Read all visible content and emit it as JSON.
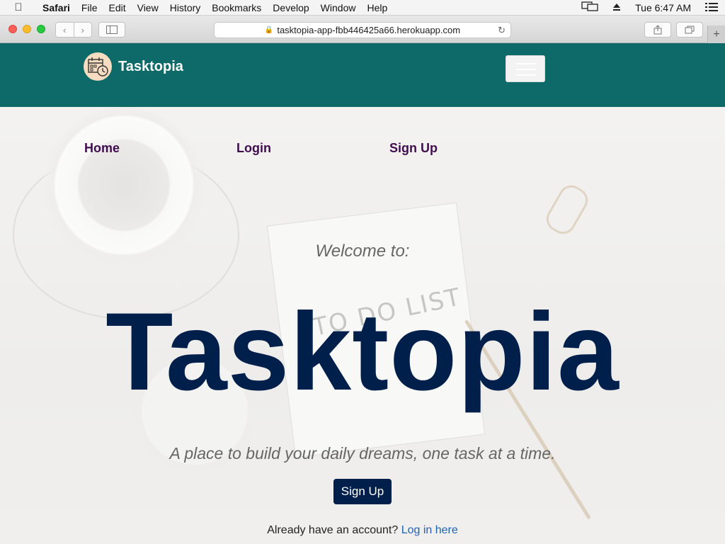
{
  "menubar": {
    "app": "Safari",
    "items": [
      "File",
      "Edit",
      "View",
      "History",
      "Bookmarks",
      "Develop",
      "Window",
      "Help"
    ],
    "clock": "Tue 6:47 AM"
  },
  "browser": {
    "url": "tasktopia-app-fbb446425a66.herokuapp.com"
  },
  "header": {
    "brand": "Tasktopia"
  },
  "nav": {
    "home": "Home",
    "login": "Login",
    "signup": "Sign Up"
  },
  "hero": {
    "welcome": "Welcome to:",
    "title": "Tasktopia",
    "tagline": "A place to build your daily dreams, one task at a time.",
    "cta": "Sign Up",
    "login_prompt": "Already have an account?",
    "login_link": "Log in here"
  },
  "colors": {
    "header": "#0d6a68",
    "title": "#00204b",
    "nav_link": "#3f0e4e",
    "link": "#1e62b4"
  }
}
